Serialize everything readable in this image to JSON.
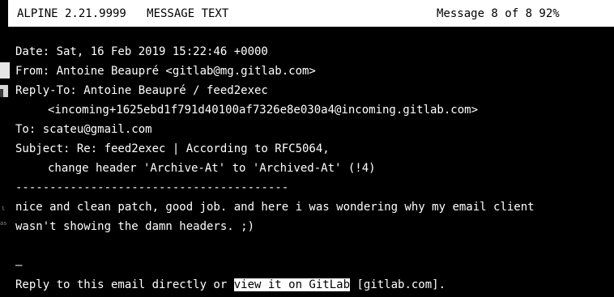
{
  "titlebar": {
    "left_text": "ALPINE 2.21.9999   MESSAGE TEXT",
    "right_text": "Message 8 of 8 92%"
  },
  "headers": {
    "date": "Date: Sat, 16 Feb 2019 15:22:46 +0000",
    "from": "From: Antoine Beaupré <gitlab@mg.gitlab.com>",
    "reply_to": "Reply-To: Antoine Beaupré / feed2exec",
    "reply_to_cont": "<incoming+1625ebd1f791d40100af7326e8e030a4@incoming.gitlab.com>",
    "to": "To: scateu@gmail.com",
    "subject": "Subject: Re: feed2exec | According to RFC5064,",
    "subject_cont": "change header 'Archive-At' to 'Archived-At' (!4)"
  },
  "body": {
    "separator": "----------------------------------------",
    "line1": "nice and clean patch, good job. and here i was wondering why my email client",
    "line2": "wasn't showing the damn headers. ;)",
    "sig_dash": "–",
    "footer_prefix": "Reply to this email directly or ",
    "footer_link": "view it on GitLab",
    "footer_suffix": " [gitlab.com]."
  },
  "colors": {
    "background": "#000000",
    "text": "#ffffff",
    "titlebar_bg": "#ffffff",
    "titlebar_text": "#000000"
  }
}
